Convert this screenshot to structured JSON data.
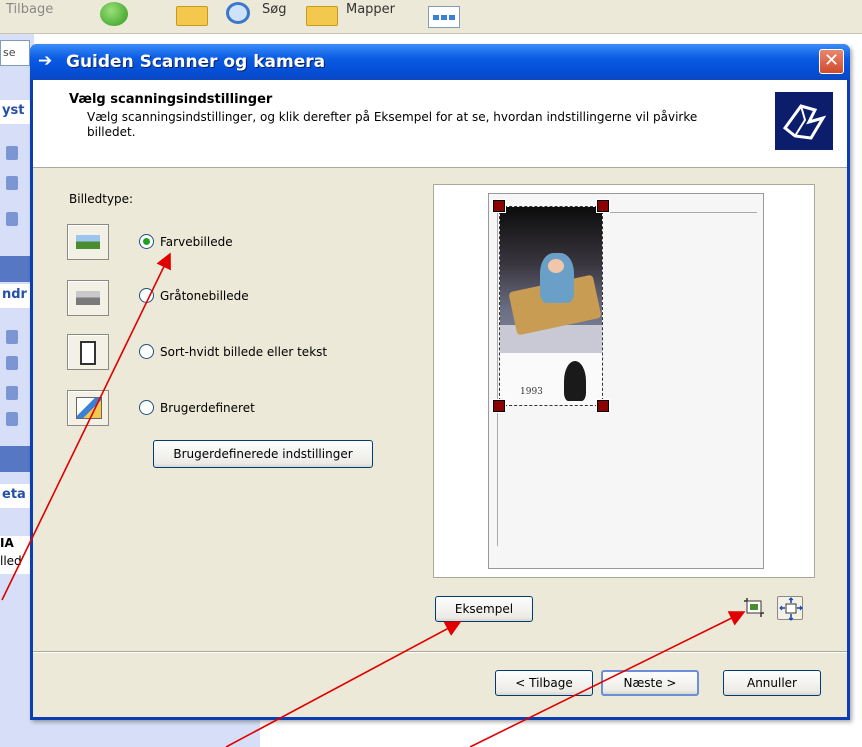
{
  "background": {
    "toolbar": {
      "back_label": "Tilbage",
      "search_label": "Søg",
      "folders_label": "Mapper"
    },
    "address_fragment": "se",
    "left_pane": {
      "section1": "yst",
      "section2": "ndr",
      "section3": "eta",
      "item_fragment1": "IA",
      "item_fragment2": "lled"
    }
  },
  "wizard": {
    "title": "Guiden Scanner og kamera",
    "header_title": "Vælg scanningsindstillinger",
    "header_subtitle": "Vælg scanningsindstillinger, og klik derefter på Eksempel for at se, hvordan indstillingerne vil påvirke billedet.",
    "image_type_label": "Billedtype:",
    "options": [
      {
        "label": "Farvebillede",
        "selected": true,
        "icon": "color-picture-icon"
      },
      {
        "label": "Gråtonebillede",
        "selected": false,
        "icon": "grayscale-picture-icon"
      },
      {
        "label": "Sort-hvidt billede eller tekst",
        "selected": false,
        "icon": "text-picture-icon"
      },
      {
        "label": "Brugerdefineret",
        "selected": false,
        "icon": "custom-picture-icon"
      }
    ],
    "custom_settings_button": "Brugerdefinerede indstillinger",
    "preview_button": "Eksempel",
    "photo_date": "1993",
    "buttons": {
      "back": "< Tilbage",
      "next": "Næste >",
      "cancel": "Annuller"
    },
    "close_symbol": "✕"
  }
}
